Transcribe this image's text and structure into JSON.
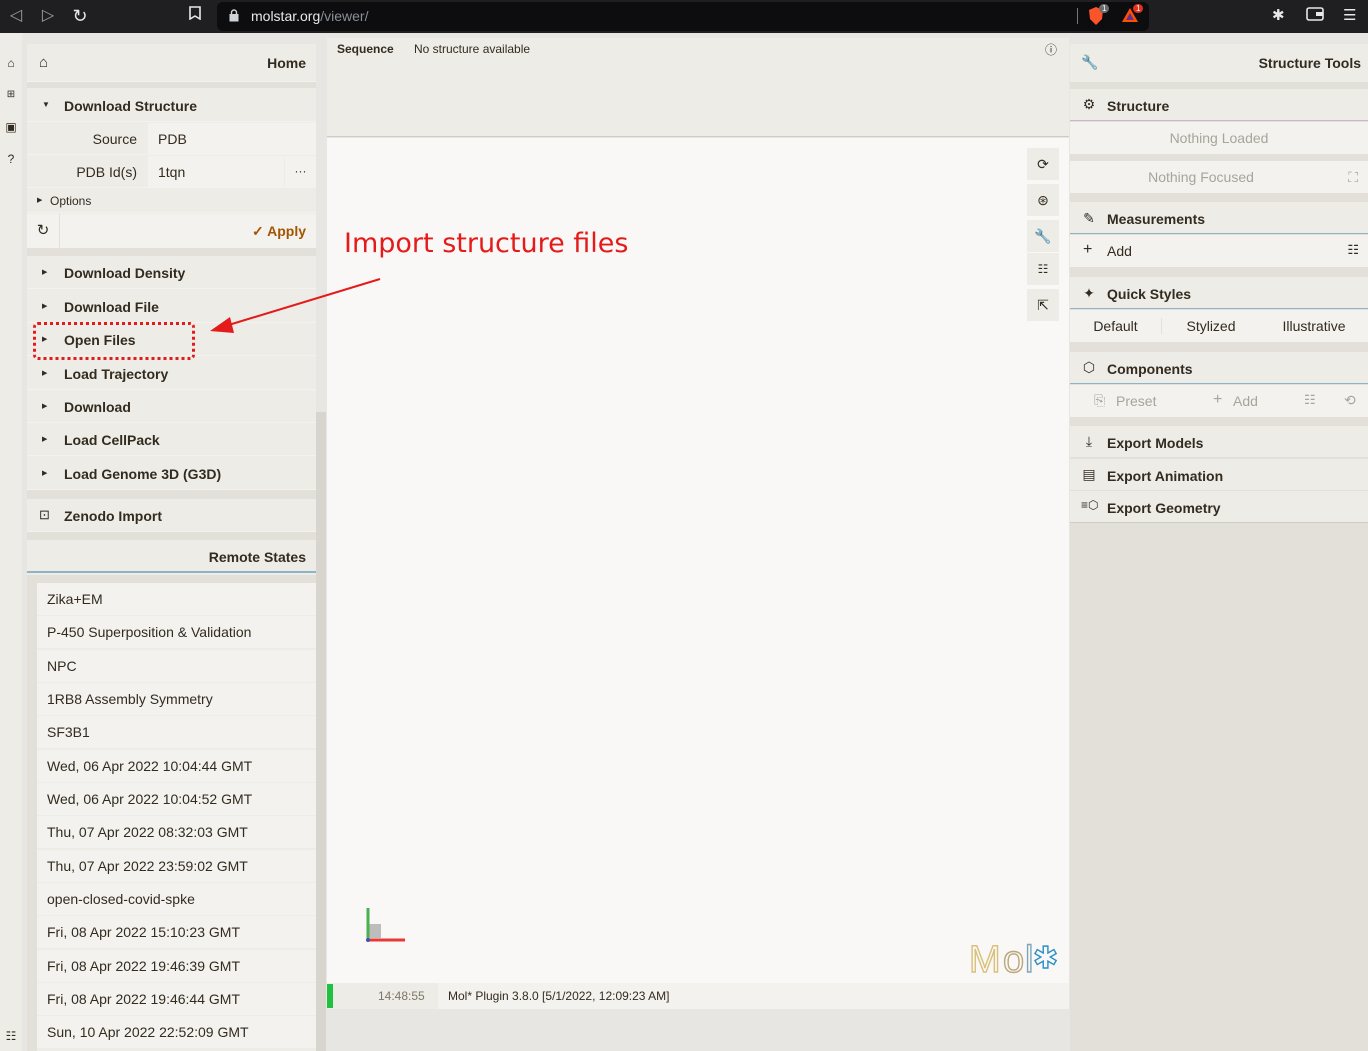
{
  "browser": {
    "url_host": "molstar.org",
    "url_path": "/viewer/",
    "brave_badge": "1",
    "bat_badge": "1"
  },
  "left": {
    "home_title": "Home",
    "download_structure": "Download Structure",
    "source_label": "Source",
    "source_value": "PDB",
    "pdb_label": "PDB Id(s)",
    "pdb_value": "1tqn",
    "more": "···",
    "options": "Options",
    "apply": "Apply",
    "items": [
      "Download Density",
      "Download File",
      "Open Files",
      "Load Trajectory",
      "Download",
      "Load CellPack",
      "Load Genome 3D (G3D)"
    ],
    "zenodo": "Zenodo Import",
    "remote_states_title": "Remote States",
    "remote_states": [
      "Zika+EM",
      "P-450 Superposition & Validation",
      "NPC",
      "1RB8 Assembly Symmetry",
      "SF3B1",
      "Wed, 06 Apr 2022 10:04:44 GMT",
      "Wed, 06 Apr 2022 10:04:52 GMT",
      "Thu, 07 Apr 2022 08:32:03 GMT",
      "Thu, 07 Apr 2022 23:59:02 GMT",
      "open-closed-covid-spke",
      "Fri, 08 Apr 2022 15:10:23 GMT",
      "Fri, 08 Apr 2022 19:46:39 GMT",
      "Fri, 08 Apr 2022 19:46:44 GMT",
      "Sun, 10 Apr 2022 22:52:09 GMT"
    ]
  },
  "middle": {
    "sequence_label": "Sequence",
    "sequence_status": "No structure available",
    "log_time": "14:48:55",
    "log_message": "Mol* Plugin 3.8.0 [5/1/2022, 12:09:23 AM]",
    "logo_text": "Mol*"
  },
  "annotation": {
    "text": "Import structure files"
  },
  "right": {
    "title": "Structure Tools",
    "structure": "Structure",
    "nothing_loaded": "Nothing Loaded",
    "nothing_focused": "Nothing Focused",
    "measurements": "Measurements",
    "add": "Add",
    "quick_styles": "Quick Styles",
    "styles": [
      "Default",
      "Stylized",
      "Illustrative"
    ],
    "components": "Components",
    "preset": "Preset",
    "comp_add": "Add",
    "export_models": "Export Models",
    "export_animation": "Export Animation",
    "export_geometry": "Export Geometry"
  },
  "colors": {
    "annotation_red": "#e31b1b",
    "apply_orange": "#a35500",
    "log_green": "#20c040"
  }
}
